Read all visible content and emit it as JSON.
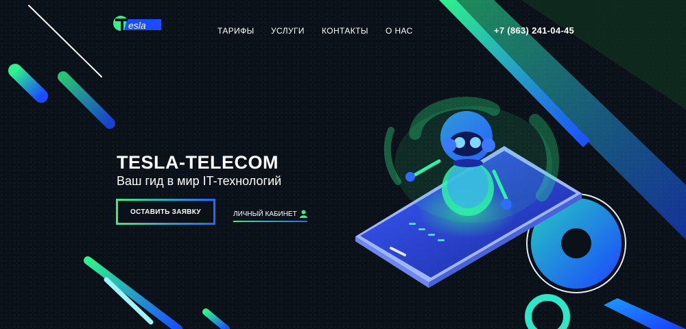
{
  "brand": {
    "logo_text": "esla"
  },
  "nav": {
    "items": [
      "ТАРИФЫ",
      "УСЛУГИ",
      "КОНТАКТЫ",
      "О НАС"
    ]
  },
  "contact": {
    "phone": "+7 (863) 241-04-45"
  },
  "hero": {
    "title": "TESLA-TELECOM",
    "subtitle": "Ваш гид в мир IT-технологий",
    "cta_label": "ОСТАВИТЬ ЗАЯВКУ",
    "cabinet_label": "ЛИЧНЫЙ КАБИНЕТ"
  },
  "colors": {
    "background": "#0a1119",
    "accent_green": "#2ef28a",
    "accent_blue": "#1b6cff"
  },
  "icons": [
    "user-icon"
  ]
}
